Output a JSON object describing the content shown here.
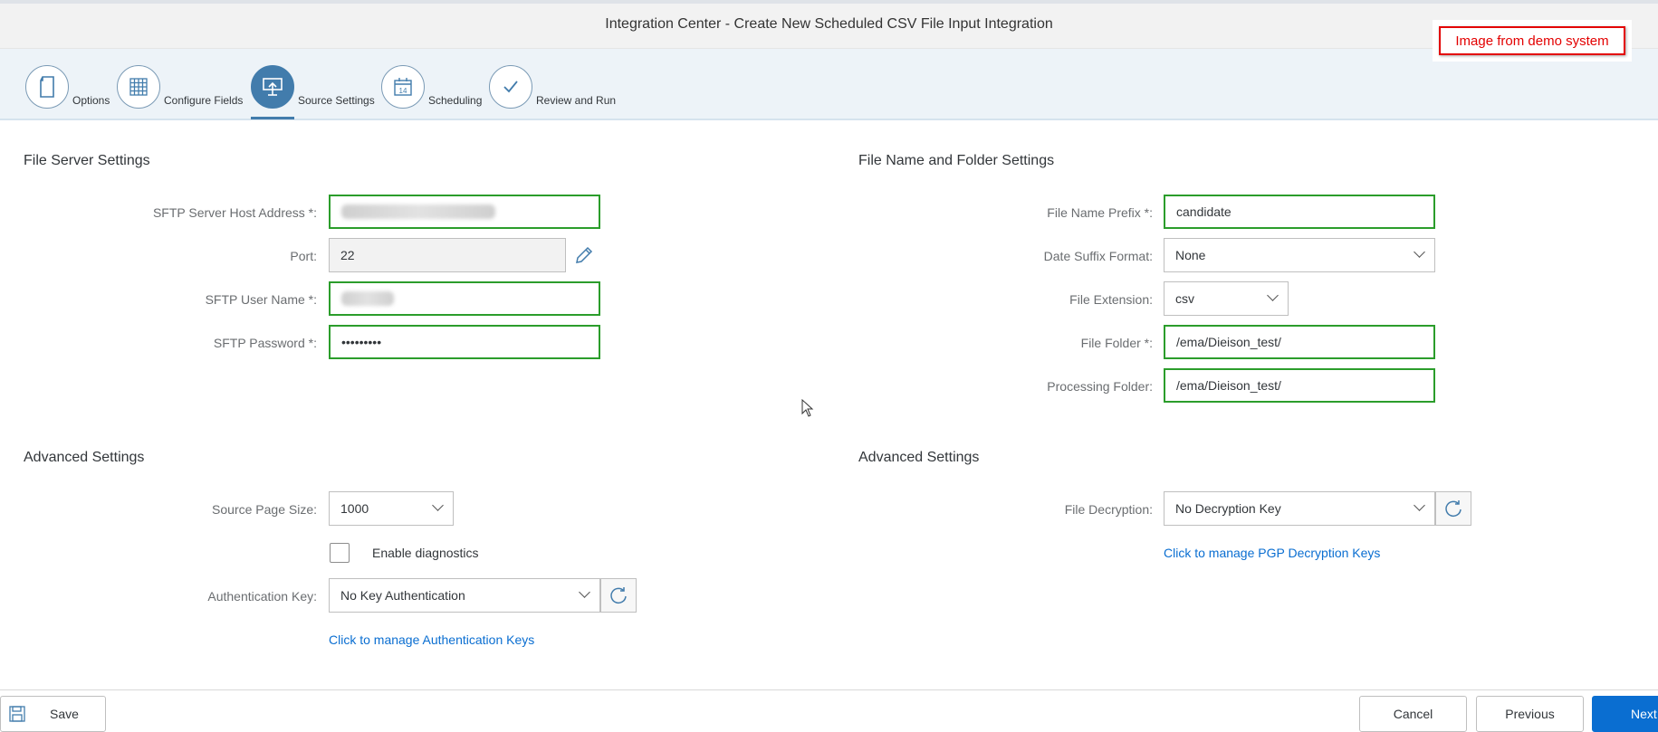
{
  "header": {
    "title": "Integration Center - Create New Scheduled CSV File Input Integration"
  },
  "demo_badge": "Image from demo system",
  "steps": [
    {
      "label": "Options",
      "icon": "document-icon"
    },
    {
      "label": "Configure Fields",
      "icon": "grid-icon"
    },
    {
      "label": "Source Settings",
      "icon": "upload-screen-icon",
      "active": true
    },
    {
      "label": "Scheduling",
      "icon": "calendar-icon",
      "day": "14"
    },
    {
      "label": "Review and Run",
      "icon": "checkmark-icon"
    }
  ],
  "file_server": {
    "title": "File Server Settings",
    "host_label": "SFTP Server Host Address *:",
    "port_label": "Port:",
    "port_value": "22",
    "user_label": "SFTP User Name *:",
    "password_label": "SFTP Password *:",
    "password_value": "•••••••••"
  },
  "file_name": {
    "title": "File Name and Folder Settings",
    "prefix_label": "File Name Prefix *:",
    "prefix_value": "candidate",
    "date_label": "Date Suffix Format:",
    "date_value": "None",
    "ext_label": "File Extension:",
    "ext_value": "csv",
    "folder_label": "File Folder *:",
    "folder_value": "/ema/Dieison_test/",
    "processing_label": "Processing Folder:",
    "processing_value": "/ema/Dieison_test/"
  },
  "adv_left": {
    "title": "Advanced Settings",
    "page_size_label": "Source Page Size:",
    "page_size_value": "1000",
    "diagnostics_label": "Enable diagnostics",
    "auth_label": "Authentication Key:",
    "auth_value": "No Key Authentication",
    "auth_link": "Click to manage Authentication Keys"
  },
  "adv_right": {
    "title": "Advanced Settings",
    "decrypt_label": "File Decryption:",
    "decrypt_value": "No Decryption Key",
    "decrypt_link": "Click to manage PGP Decryption Keys"
  },
  "footer": {
    "save": "Save",
    "cancel": "Cancel",
    "previous": "Previous",
    "next": "Next"
  },
  "colors": {
    "accent": "#427cac",
    "valid_border": "#2b9d2b",
    "link": "#0a6ed1",
    "badge": "#e30000"
  }
}
